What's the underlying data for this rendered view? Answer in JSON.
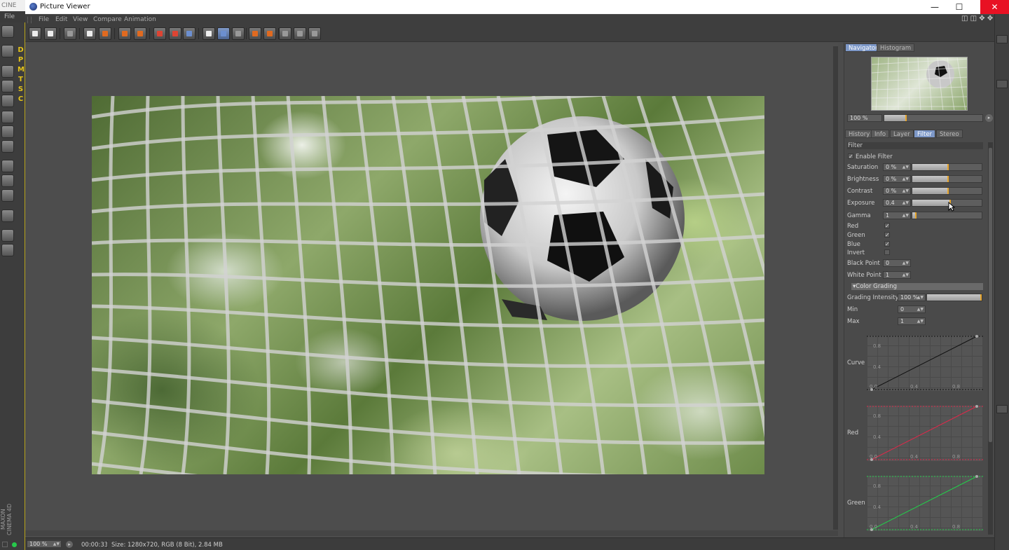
{
  "background_app": {
    "title_fragment": "CINE",
    "menu_file": "File",
    "side_tags": [
      "D",
      "P",
      "M",
      "T",
      "S",
      "C"
    ],
    "brand_maxon": "MAXON",
    "brand_c4d": "CINEMA 4D"
  },
  "window": {
    "title": "Picture Viewer",
    "minimize": "—",
    "maximize": "☐",
    "close": "✕"
  },
  "menu": [
    "File",
    "Edit",
    "View",
    "Compare",
    "Animation"
  ],
  "toolbar_icons": [
    "open-icon",
    "save-icon",
    "grid-icon",
    "region-icon",
    "clapper-icon",
    "export-icon",
    "import-icon",
    "frame-a-icon",
    "frame-b-icon",
    "render-icon",
    "compare-icon",
    "split-icon",
    "ab-icon",
    "set-a-icon",
    "set-b-icon",
    "swap-icon",
    "stack-icon",
    "side-icon"
  ],
  "navigator": {
    "tabs": [
      "Navigator",
      "Histogram"
    ],
    "active_tab": "Navigator",
    "zoom": "100 %"
  },
  "panel_tabs": [
    "History",
    "Info",
    "Layer",
    "Filter",
    "Stereo"
  ],
  "active_panel_tab": "Filter",
  "filter": {
    "header": "Filter",
    "enable_label": "Enable Filter",
    "enabled": true,
    "sliders": [
      {
        "label": "Saturation",
        "value": "0 %",
        "level": 0.5
      },
      {
        "label": "Brightness",
        "value": "0 %",
        "level": 0.5
      },
      {
        "label": "Contrast",
        "value": "0 %",
        "level": 0.5
      },
      {
        "label": "Exposure",
        "value": "0.4",
        "level": 0.53
      },
      {
        "label": "Gamma",
        "value": "1",
        "level": 0.04
      }
    ],
    "channels": [
      {
        "label": "Red",
        "checked": true
      },
      {
        "label": "Green",
        "checked": true
      },
      {
        "label": "Blue",
        "checked": true
      },
      {
        "label": "Invert",
        "checked": false
      }
    ],
    "black_point": {
      "label": "Black Point",
      "value": "0"
    },
    "white_point": {
      "label": "White Point",
      "value": "1"
    },
    "color_grading": {
      "header": "Color Grading",
      "intensity_label": "Grading Intensity",
      "intensity_value": "100 %",
      "intensity_level": 1.0,
      "min_label": "Min",
      "min_value": "0",
      "max_label": "Max",
      "max_value": "1"
    },
    "curves": [
      {
        "label": "Curve",
        "color": "#111111"
      },
      {
        "label": "Red",
        "color": "#e0284a"
      },
      {
        "label": "Green",
        "color": "#22d04a"
      }
    ],
    "curve_ticks": {
      "y_hi": "0.8",
      "y_mid": "0.4",
      "x_0": "0.0",
      "x_mid": "0.4",
      "x_hi": "0.8"
    }
  },
  "status": {
    "zoom": "100 %",
    "time": "00:00:33",
    "info": "Size: 1280x720, RGB (8 Bit), 2.84 MB"
  },
  "colors": {
    "accent": "#7d98c8",
    "slider_marker": "#e7a52c",
    "close_red": "#e81123"
  }
}
